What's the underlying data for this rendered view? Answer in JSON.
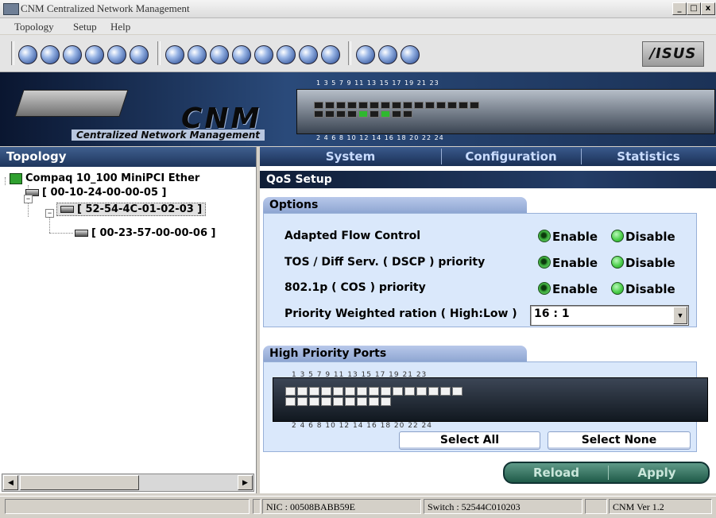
{
  "window": {
    "title": "CNM  Centralized Network Management",
    "controls": {
      "minimize": "_",
      "maximize": "□",
      "close": "x"
    }
  },
  "menu": {
    "items": [
      "Topology",
      "Setup",
      "Help"
    ]
  },
  "toolbar": {
    "icons": [
      "globe-icon",
      "refresh-icon",
      "save-icon",
      "device-icon",
      "link-icon",
      "help-icon",
      "map-icon",
      "config-icon",
      "trap-icon",
      "monitor-icon",
      "stats-icon",
      "chart-icon",
      "search-icon",
      "globe2-icon",
      "print-icon",
      "tools-icon",
      "network-icon"
    ],
    "brand": "/ISUS"
  },
  "banner": {
    "logo": "CNM",
    "subtitle": "Centralized Network Management",
    "top_ports": "1  3  5  7   9  11 13 15   17 19 21 23",
    "bottom_ports": "2  4  6  8   10 12 14 16   18 20 22 24"
  },
  "topology": {
    "header": "Topology",
    "tree": [
      {
        "label": "Compaq 10_100 MiniPCI Ether",
        "level": 0
      },
      {
        "label": "[ 00-10-24-00-00-05 ]",
        "level": 1
      },
      {
        "label": "[ 52-54-4C-01-02-03 ]",
        "level": 2,
        "selected": true
      },
      {
        "label": "[ 00-23-57-00-00-06 ]",
        "level": 3
      }
    ]
  },
  "tabs": [
    "System",
    "Configuration",
    "Statistics"
  ],
  "qos": {
    "header": "QoS Setup",
    "options_label": "Options",
    "options": [
      {
        "label": "Adapted Flow Control",
        "enable": "Enable",
        "disable": "Disable",
        "selected": "enable"
      },
      {
        "label": "TOS / Diff Serv. ( DSCP ) priority",
        "enable": "Enable",
        "disable": "Disable",
        "selected": "enable"
      },
      {
        "label": "802.1p ( COS ) priority",
        "enable": "Enable",
        "disable": "Disable",
        "selected": "enable"
      }
    ],
    "weight_label": "Priority Weighted ration ( High:Low )",
    "weight_value": "16 : 1",
    "hp_label": "High Priority Ports",
    "hp_top_ports": "1  3  5  7   9  11 13 15   17 19 21 23",
    "hp_bottom_ports": "2  4  6  8   10 12 14 16   18 20 22 24",
    "select_all": "Select All",
    "select_none": "Select None",
    "reload": "Reload",
    "apply": "Apply"
  },
  "status": {
    "nic": "NIC : 00508BABB59E",
    "switch": "Switch : 52544C010203",
    "version": "CNM Ver 1.2"
  },
  "colors": {
    "accent": "#1e355c",
    "panel": "#dae8fb",
    "enable": "#3aa93a"
  }
}
